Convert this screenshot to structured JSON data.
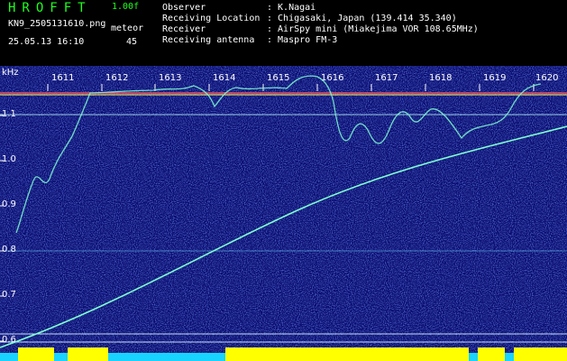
{
  "header": {
    "app_name": "HROFFT",
    "version": "1.00f",
    "file_name": "KN9_2505131610.png",
    "datetime": "25.05.13 16:10",
    "meteor_label": "meteor",
    "meteor_count": "45",
    "info": [
      {
        "key": "Observer",
        "value": ": K.Nagai"
      },
      {
        "key": "Receiving Location",
        "value": ": Chigasaki, Japan (139.414 35.340)"
      },
      {
        "key": "Receiver",
        "value": ": AirSpy mini (Miakejima VOR 108.65MHz)"
      },
      {
        "key": "Receiving antenna",
        "value": ": Maspro FM-3"
      }
    ]
  },
  "plot": {
    "y_unit": "kHz",
    "y_ticks": [
      "1.1",
      "1.0",
      "0.9",
      "0.8",
      "0.7",
      "0.6"
    ],
    "minute_labels": [
      "1611",
      "1612",
      "1613",
      "1614",
      "1615",
      "1616",
      "1617",
      "1618",
      "1619",
      "1620"
    ],
    "colors": {
      "background": "#0b0c6e",
      "trace": "#7fffd0",
      "signal_bar": "#ffff00",
      "noise_floor": "#19d3ff"
    }
  }
}
